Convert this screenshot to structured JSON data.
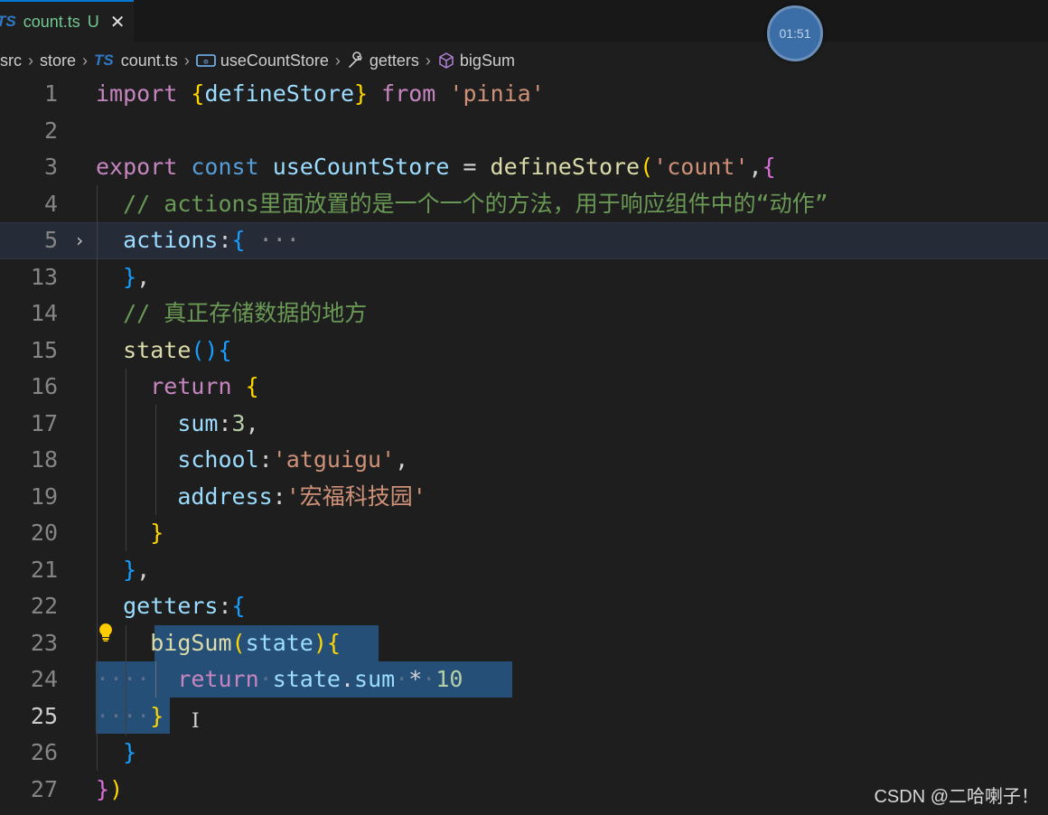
{
  "tab": {
    "lang_badge": "TS",
    "filename": "count.ts",
    "status": "U",
    "close_glyph": "✕"
  },
  "timer": {
    "text": "01:51"
  },
  "breadcrumb": {
    "items": [
      "src",
      "store",
      "count.ts",
      "useCountStore",
      "getters",
      "bigSum"
    ],
    "ts_badge": "TS"
  },
  "editor": {
    "line_numbers": [
      "1",
      "2",
      "3",
      "4",
      "5",
      "13",
      "14",
      "15",
      "16",
      "17",
      "18",
      "19",
      "20",
      "21",
      "22",
      "23",
      "24",
      "25",
      "26",
      "27"
    ],
    "active_line": "25",
    "folded_line": "5",
    "lines": [
      [
        [
          "kw",
          "import"
        ],
        [
          "op",
          " "
        ],
        [
          "p1",
          "{"
        ],
        [
          "id",
          "defineStore"
        ],
        [
          "p1",
          "}"
        ],
        [
          "op",
          " "
        ],
        [
          "kw",
          "from"
        ],
        [
          "op",
          " "
        ],
        [
          "st",
          "'pinia'"
        ]
      ],
      [],
      [
        [
          "kw",
          "export"
        ],
        [
          "op",
          " "
        ],
        [
          "kb",
          "const"
        ],
        [
          "op",
          " "
        ],
        [
          "id",
          "useCountStore"
        ],
        [
          "op",
          " = "
        ],
        [
          "fn",
          "defineStore"
        ],
        [
          "p1",
          "("
        ],
        [
          "st",
          "'count'"
        ],
        [
          "op",
          ","
        ],
        [
          "p2",
          "{"
        ]
      ],
      [
        [
          "op",
          "  "
        ],
        [
          "cm",
          "// actions里面放置的是一个一个的方法，用于响应组件中的“动作”"
        ]
      ],
      [
        [
          "op",
          "  "
        ],
        [
          "id",
          "actions"
        ],
        [
          "op",
          ":"
        ],
        [
          "p3",
          "{"
        ],
        [
          "op",
          " "
        ],
        [
          "dim",
          "···"
        ]
      ],
      [
        [
          "op",
          "  "
        ],
        [
          "p3",
          "}"
        ],
        [
          "op",
          ","
        ]
      ],
      [
        [
          "op",
          "  "
        ],
        [
          "cm",
          "// 真正存储数据的地方"
        ]
      ],
      [
        [
          "op",
          "  "
        ],
        [
          "fn",
          "state"
        ],
        [
          "p3",
          "()"
        ],
        [
          "p3",
          "{"
        ]
      ],
      [
        [
          "op",
          "    "
        ],
        [
          "kw",
          "return"
        ],
        [
          "op",
          " "
        ],
        [
          "p1",
          "{"
        ]
      ],
      [
        [
          "op",
          "      "
        ],
        [
          "id",
          "sum"
        ],
        [
          "op",
          ":"
        ],
        [
          "nu",
          "3"
        ],
        [
          "op",
          ","
        ]
      ],
      [
        [
          "op",
          "      "
        ],
        [
          "id",
          "school"
        ],
        [
          "op",
          ":"
        ],
        [
          "st",
          "'atguigu'"
        ],
        [
          "op",
          ","
        ]
      ],
      [
        [
          "op",
          "      "
        ],
        [
          "id",
          "address"
        ],
        [
          "op",
          ":"
        ],
        [
          "st",
          "'宏福科技园'"
        ]
      ],
      [
        [
          "op",
          "    "
        ],
        [
          "p1",
          "}"
        ]
      ],
      [
        [
          "op",
          "  "
        ],
        [
          "p3",
          "}"
        ],
        [
          "op",
          ","
        ]
      ],
      [
        [
          "op",
          "  "
        ],
        [
          "id",
          "getters"
        ],
        [
          "op",
          ":"
        ],
        [
          "p3",
          "{"
        ]
      ],
      [
        [
          "op",
          "    "
        ],
        [
          "fn",
          "bigSum"
        ],
        [
          "p1",
          "("
        ],
        [
          "id",
          "state"
        ],
        [
          "p1",
          ")"
        ],
        [
          "p1",
          "{"
        ]
      ],
      [
        [
          "ws",
          "····  "
        ],
        [
          "kw",
          "return"
        ],
        [
          "ws",
          "·"
        ],
        [
          "id",
          "state"
        ],
        [
          "op",
          "."
        ],
        [
          "id",
          "sum"
        ],
        [
          "ws",
          "·"
        ],
        [
          "op",
          "*"
        ],
        [
          "ws",
          "·"
        ],
        [
          "nu",
          "10"
        ]
      ],
      [
        [
          "ws",
          "····"
        ],
        [
          "p1",
          "}"
        ]
      ],
      [
        [
          "op",
          "  "
        ],
        [
          "p3",
          "}"
        ]
      ],
      [
        [
          "p2",
          "}"
        ],
        [
          "p1",
          ")"
        ]
      ]
    ]
  },
  "watermark": {
    "text": "CSDN @二哈喇子！"
  }
}
